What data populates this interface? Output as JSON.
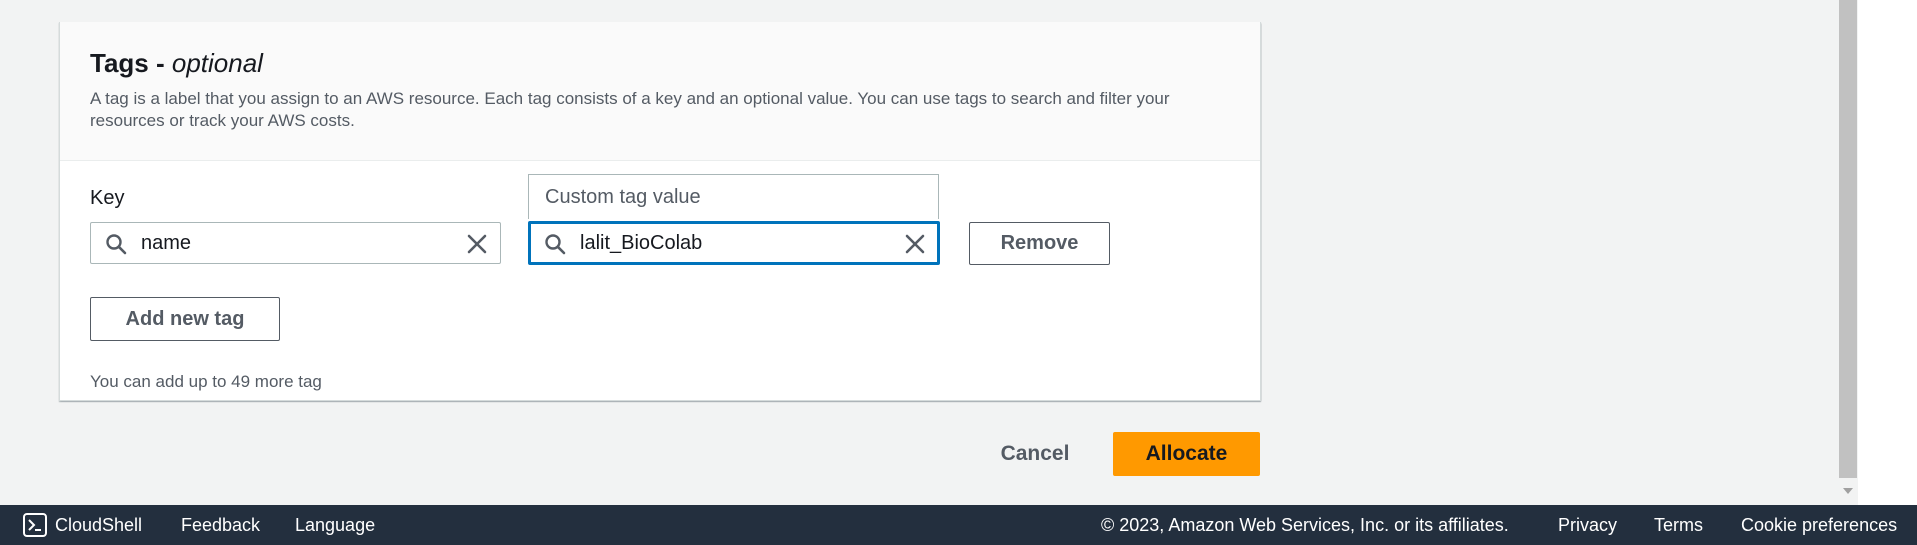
{
  "tags": {
    "title": "Tags - ",
    "title_optional": "optional",
    "description": "A tag is a label that you assign to an AWS resource. Each tag consists of a key and an optional value. You can use tags to search and filter your resources or track your AWS costs.",
    "key_label": "Key",
    "key_value": "name",
    "value_value": "lalit_BioColab",
    "dropdown_option": "Custom tag value",
    "remove_label": "Remove",
    "add_label": "Add new tag",
    "hint": "You can add up to 49 more tag"
  },
  "actions": {
    "cancel_label": "Cancel",
    "allocate_label": "Allocate"
  },
  "footer": {
    "cloudshell": "CloudShell",
    "feedback": "Feedback",
    "language": "Language",
    "copyright": "© 2023, Amazon Web Services, Inc. or its affiliates.",
    "privacy": "Privacy",
    "terms": "Terms",
    "cookies": "Cookie preferences"
  },
  "colors": {
    "primary_button": "#ff9900",
    "footer_bg": "#232f3e",
    "focus_border": "#0073bb",
    "page_bg": "#f2f3f3"
  },
  "icons": [
    "search-icon",
    "close-icon",
    "cloudshell-icon",
    "scroll-down-arrow-icon"
  ]
}
